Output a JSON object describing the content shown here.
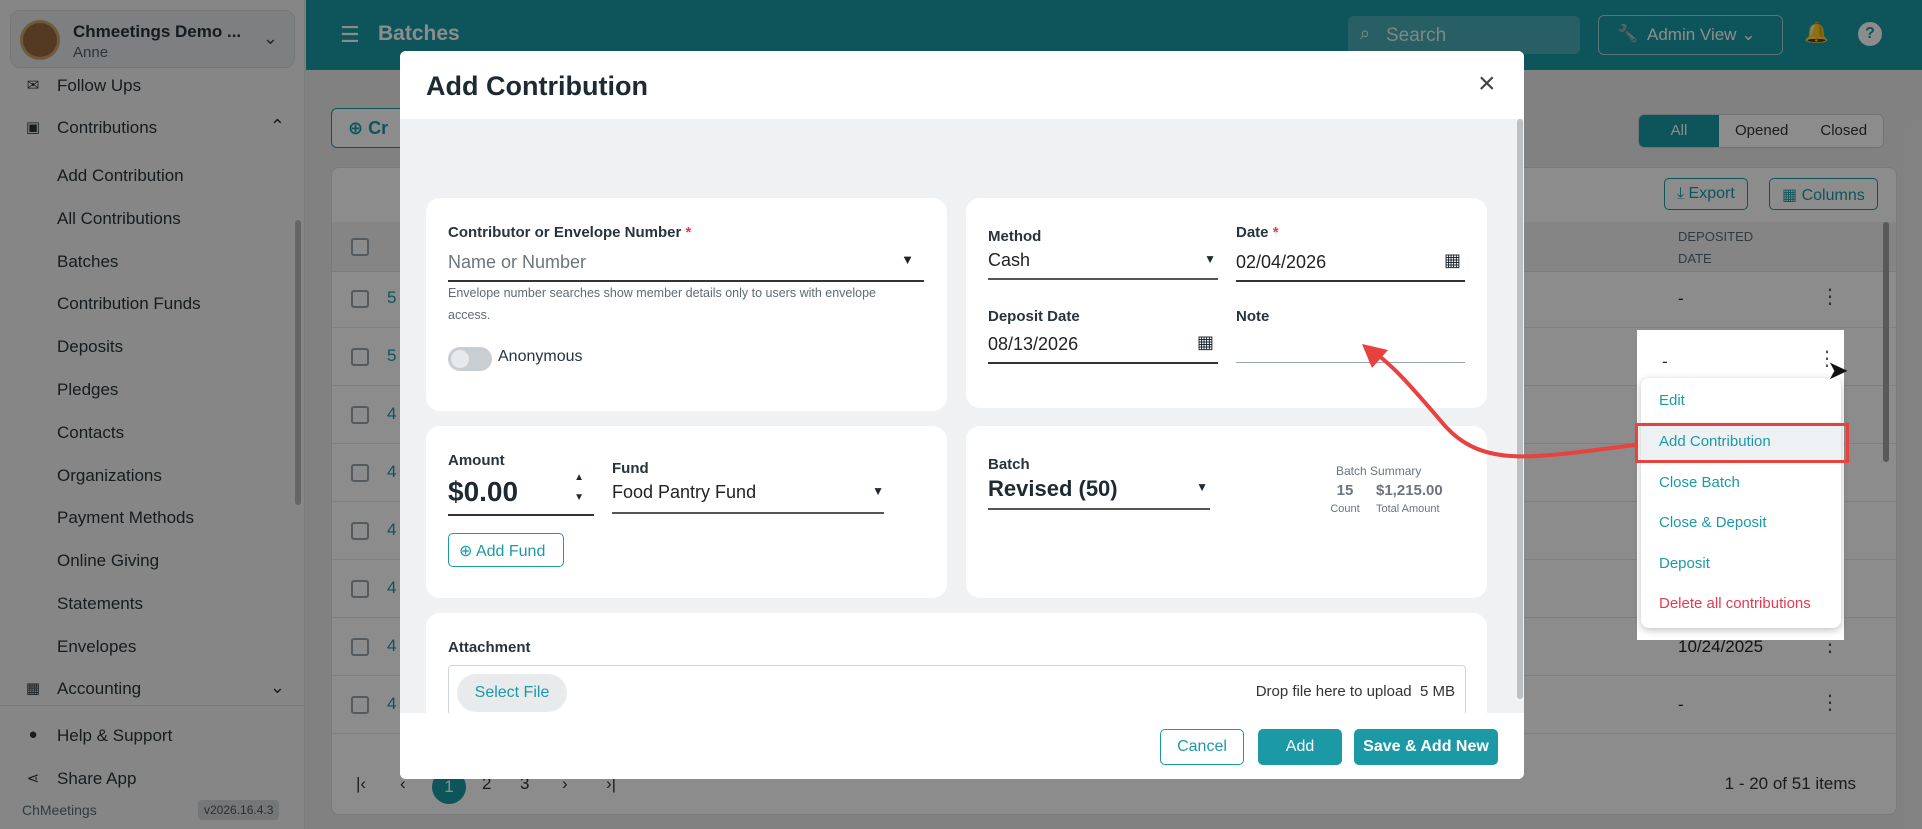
{
  "sidebar": {
    "org_name": "Chmeetings Demo ...",
    "user": "Anne",
    "items": [
      {
        "label": "Follow Ups"
      },
      {
        "label": "Contributions"
      },
      {
        "label": "Add Contribution"
      },
      {
        "label": "All Contributions"
      },
      {
        "label": "Batches"
      },
      {
        "label": "Contribution Funds"
      },
      {
        "label": "Deposits"
      },
      {
        "label": "Pledges"
      },
      {
        "label": "Contacts"
      },
      {
        "label": "Organizations"
      },
      {
        "label": "Payment Methods"
      },
      {
        "label": "Online Giving"
      },
      {
        "label": "Statements"
      },
      {
        "label": "Envelopes"
      },
      {
        "label": "Accounting"
      }
    ],
    "help": "Help & Support",
    "share": "Share App",
    "brand": "ChMeetings",
    "version": "v2026.16.4.3"
  },
  "header": {
    "title": "Batches",
    "search_placeholder": "Search",
    "admin_view": "Admin View"
  },
  "background": {
    "create_label": "Cr",
    "filters": [
      "All",
      "Opened",
      "Closed"
    ],
    "export": "Export",
    "columns": "Columns",
    "deposited_date_header": [
      "DEPOSITED",
      "DATE"
    ],
    "rows": [
      {
        "id": "5",
        "deposited": "-"
      },
      {
        "id": "5",
        "deposited": "-"
      },
      {
        "id": "4",
        "deposited": ""
      },
      {
        "id": "4",
        "deposited": ""
      },
      {
        "id": "4",
        "deposited": ""
      },
      {
        "id": "4",
        "deposited": ""
      },
      {
        "id": "4",
        "deposited": "10/24/2025"
      },
      {
        "id": "4",
        "deposited": "-"
      }
    ],
    "pages": [
      "1",
      "2",
      "3"
    ],
    "items_summary": "1 - 20 of 51 items"
  },
  "menu": {
    "row_dash": "-",
    "items": [
      "Edit",
      "Add Contribution",
      "Close Batch",
      "Close & Deposit",
      "Deposit",
      "Delete all contributions"
    ]
  },
  "modal": {
    "title": "Add Contribution",
    "contributor_label": "Contributor or Envelope Number",
    "contributor_placeholder": "Name or Number",
    "contributor_hint": "Envelope number searches show member details only to users with envelope access.",
    "anonymous": "Anonymous",
    "method_label": "Method",
    "method_value": "Cash",
    "date_label": "Date",
    "date_value": "02/04/2026",
    "deposit_date_label": "Deposit Date",
    "deposit_date_value": "08/13/2026",
    "note_label": "Note",
    "amount_label": "Amount",
    "amount_value": "$0.00",
    "fund_label": "Fund",
    "fund_value": "Food Pantry Fund",
    "add_fund": "Add Fund",
    "batch_label": "Batch",
    "batch_value": "Revised (50)",
    "batch_summary_label": "Batch Summary",
    "batch_count": "15",
    "batch_count_label": "Count",
    "batch_total": "$1,215.00",
    "batch_total_label": "Total Amount",
    "attachment_label": "Attachment",
    "select_file": "Select File",
    "drop_text": "Drop file here to upload",
    "max_size": "5 MB",
    "cancel": "Cancel",
    "add": "Add",
    "save_add_new": "Save & Add New"
  },
  "colors": {
    "accent": "#1b9aa6",
    "danger": "#e53950",
    "annotation": "#e8413e"
  }
}
